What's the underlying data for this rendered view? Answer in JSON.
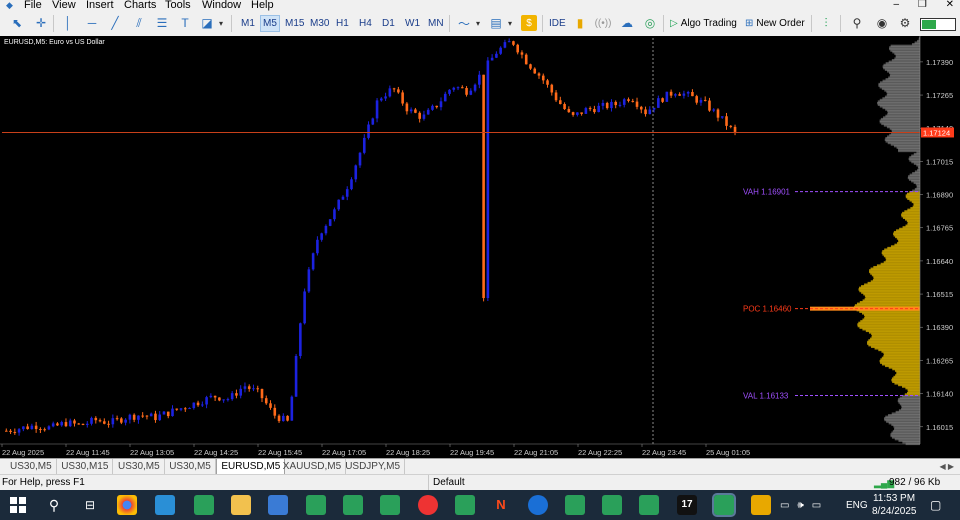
{
  "menu": {
    "items": [
      "File",
      "View",
      "Insert",
      "Charts",
      "Tools",
      "Window",
      "Help"
    ]
  },
  "toolbar": {
    "timeframes": [
      "M1",
      "M5",
      "M15",
      "M30",
      "H1",
      "H4",
      "D1",
      "W1",
      "MN"
    ],
    "active_timeframe": "M5",
    "ide_label": "IDE",
    "algo_label": "Algo Trading",
    "new_order_label": "New Order"
  },
  "chart": {
    "title": "EURUSD,M5:  Euro vs US Dollar",
    "current_price": "1.17124",
    "price_labels": [
      "1.17390",
      "1.17265",
      "1.17140",
      "1.17015",
      "1.16890",
      "1.16765",
      "1.16640",
      "1.16515",
      "1.16390",
      "1.16265",
      "1.16140",
      "1.16015"
    ],
    "time_labels": [
      "22 Aug 2025",
      "22 Aug 11:45",
      "22 Aug 13:05",
      "22 Aug 14:25",
      "22 Aug 15:45",
      "22 Aug 17:05",
      "22 Aug 18:25",
      "22 Aug 19:45",
      "22 Aug 21:05",
      "22 Aug 22:25",
      "22 Aug 23:45",
      "25 Aug 01:05"
    ],
    "vah_label": "VAH 1.16901",
    "poc_label": "POC 1.16460",
    "val_label": "VAL 1.16133",
    "colors": {
      "bull": "#1c22e0",
      "bear": "#ff6a1a",
      "vah": "#a050ff",
      "poc": "#ff3b1a",
      "price_line": "#c8401a",
      "value_area": "#c8a200",
      "outside": "#8a8a8a"
    }
  },
  "chart_data": {
    "type": "candlestick",
    "series_up_color": "blue",
    "series_down_color": "orange",
    "close_path": [
      1.16,
      1.1601,
      1.1602,
      1.1601,
      1.1603,
      1.1602,
      1.1604,
      1.1603,
      1.1605,
      1.1606,
      1.1605,
      1.1607,
      1.1609,
      1.1611,
      1.1613,
      1.1612,
      1.1617,
      1.1614,
      1.1606,
      1.1603,
      1.1652,
      1.1674,
      1.1682,
      1.1693,
      1.1708,
      1.1725,
      1.1729,
      1.1721,
      1.1718,
      1.1723,
      1.173,
      1.1728,
      1.1735,
      1.1743,
      1.1747,
      1.1739,
      1.1733,
      1.1725,
      1.1718,
      1.1721,
      1.1722,
      1.1723,
      1.1726,
      1.172,
      1.1725,
      1.1728,
      1.1726,
      1.1723,
      1.1718,
      1.1712
    ],
    "ylim": [
      1.1595,
      1.1748
    ],
    "value_area_high": 1.16901,
    "point_of_control": 1.1646,
    "value_area_low": 1.16133,
    "current_price": 1.17124
  },
  "tabs": [
    "US30,M5",
    "US30,M15",
    "US30,M5",
    "US30,M5",
    "EURUSD,M5",
    "XAUUSD,M5",
    "USDJPY,M5"
  ],
  "active_tab": "EURUSD,M5",
  "status": {
    "help": "For Help, press F1",
    "profile": "Default",
    "traffic": "982 / 96 Kb"
  },
  "taskbar": {
    "time": "11:53 PM",
    "date": "8/24/2025",
    "lang": "ENG"
  }
}
